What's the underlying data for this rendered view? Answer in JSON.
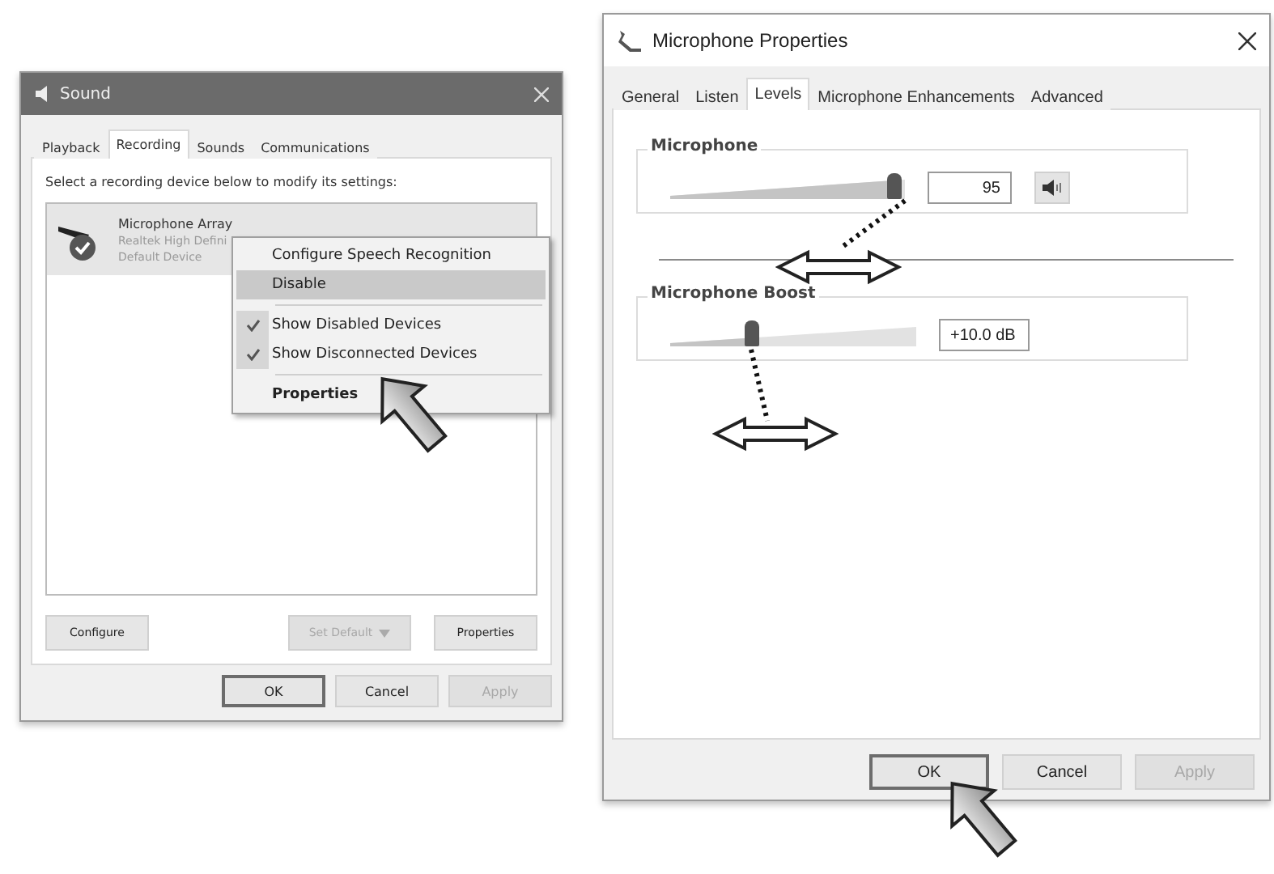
{
  "sound_window": {
    "title": "Sound",
    "tabs": [
      {
        "label": "Playback",
        "selected": false
      },
      {
        "label": "Recording",
        "selected": true
      },
      {
        "label": "Sounds",
        "selected": false
      },
      {
        "label": "Communications",
        "selected": false
      }
    ],
    "instruction": "Select a recording device below to modify its settings:",
    "devices": [
      {
        "name": "Microphone Array",
        "driver": "Realtek High Defini",
        "status": "Default Device",
        "selected": true
      }
    ],
    "context_menu": [
      {
        "kind": "item",
        "label": "Configure Speech Recognition",
        "checked": false,
        "highlighted": false,
        "default": false
      },
      {
        "kind": "item",
        "label": "Disable",
        "checked": false,
        "highlighted": true,
        "default": false
      },
      {
        "kind": "separator"
      },
      {
        "kind": "item",
        "label": "Show Disabled Devices",
        "checked": true,
        "highlighted": false,
        "default": false
      },
      {
        "kind": "item",
        "label": "Show Disconnected Devices",
        "checked": true,
        "highlighted": false,
        "default": false
      },
      {
        "kind": "separator"
      },
      {
        "kind": "item",
        "label": "Properties",
        "checked": false,
        "highlighted": false,
        "default": true
      }
    ],
    "panel_buttons": [
      {
        "label": "Configure",
        "disabled": false,
        "dropdown": false
      },
      {
        "label": "Set Default",
        "disabled": true,
        "dropdown": true
      },
      {
        "label": "Properties",
        "disabled": false,
        "dropdown": false
      }
    ],
    "dialog_buttons": [
      {
        "label": "OK",
        "disabled": false,
        "focused": true
      },
      {
        "label": "Cancel",
        "disabled": false,
        "focused": false
      },
      {
        "label": "Apply",
        "disabled": true,
        "focused": false
      }
    ]
  },
  "properties_window": {
    "title": "Microphone Properties",
    "tabs": [
      {
        "label": "General",
        "selected": false
      },
      {
        "label": "Listen",
        "selected": false
      },
      {
        "label": "Levels",
        "selected": true
      },
      {
        "label": "Microphone Enhancements",
        "selected": false
      },
      {
        "label": "Advanced",
        "selected": false
      }
    ],
    "groups": [
      {
        "label": "Microphone",
        "level": 0.95,
        "value": "95",
        "mute_button": true
      },
      {
        "label": "Microphone Boost",
        "level": 0.33,
        "value": "+10.0 dB",
        "mute_button": false
      }
    ],
    "dialog_buttons": [
      {
        "label": "OK",
        "disabled": false,
        "focused": true
      },
      {
        "label": "Cancel",
        "disabled": false,
        "focused": false
      },
      {
        "label": "Apply",
        "disabled": true,
        "focused": false
      }
    ]
  }
}
